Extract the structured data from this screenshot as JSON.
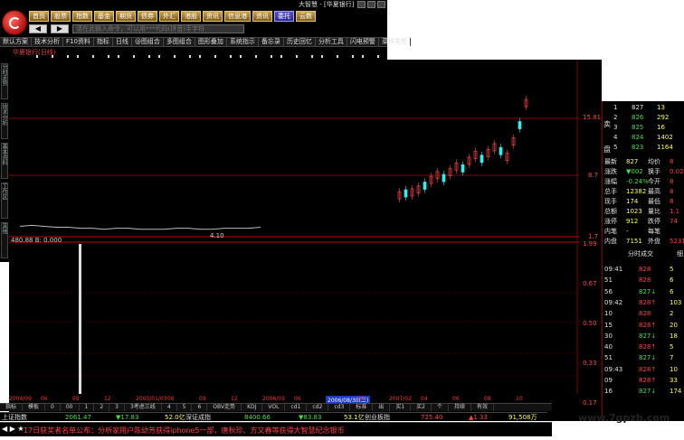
{
  "window": {
    "title": "大智慧 - [华夏银行]"
  },
  "topnav": [
    "首页",
    "股票",
    "指数",
    "基金",
    "期货",
    "债券",
    "外汇",
    "港股",
    "资讯",
    "信息港",
    "资讯",
    "委托",
    "云数"
  ],
  "search": {
    "placeholder": "请在此输入命令，可以用***代码(拼音)手字符",
    "back": "◀",
    "fwd": "▶"
  },
  "toolbar": [
    "默认方案",
    "技术分析",
    "F10资料",
    "指标",
    "日线",
    "@图组合",
    "多图组合",
    "图形叠加",
    "系统指示",
    "备忘录",
    "历史回忆",
    "分析工具",
    "闪电预警",
    "菜样类型"
  ],
  "stock_name": "华夏银行(日线)",
  "vtabs": [
    "分时走势",
    "技术分析",
    "基本资料",
    "工作区",
    "其他"
  ],
  "price_labels": {
    "p1": "15.81",
    "p2": "8.7",
    "p3": "1.7",
    "left_info": "480.88 B: 0.000",
    "right_small": [
      "1.99",
      "0.67",
      "0.50",
      "0.33",
      "0.17"
    ]
  },
  "chart_extra": {
    "low_label": "4.10"
  },
  "order_book": {
    "sell_label": "卖",
    "buy_label": "盘",
    "rows": [
      {
        "idx": "1",
        "price": "827",
        "vol": "13"
      },
      {
        "idx": "2",
        "price": "826",
        "vol": "292"
      },
      {
        "idx": "3",
        "price": "825",
        "vol": "16"
      },
      {
        "idx": "4",
        "price": "824",
        "vol": "1402"
      },
      {
        "idx": "5",
        "price": "823",
        "vol": "1164"
      }
    ]
  },
  "quote": [
    {
      "l": "最新",
      "lv": "827",
      "r": "均价",
      "rv": "8"
    },
    {
      "l": "涨跌",
      "lv": "▼002",
      "r": "换手",
      "rv": "0.02%"
    },
    {
      "l": "涨幅",
      "lv": "-0.24%",
      "r": "今开",
      "rv": "8"
    },
    {
      "l": "总手",
      "lv": "12382",
      "r": "最高",
      "rv": "8"
    },
    {
      "l": "现手",
      "lv": "174",
      "r": "最低",
      "rv": "8"
    },
    {
      "l": "总额",
      "lv": "1023",
      "r": "量比",
      "rv": "1.1"
    },
    {
      "l": "涨停",
      "lv": "912",
      "r": "跌停",
      "rv": "74"
    },
    {
      "l": "内笔",
      "lv": "-",
      "r": "每笔",
      "rv": ""
    },
    {
      "l": "内盘",
      "lv": "7151",
      "r": "外盘",
      "rv": "5231"
    }
  ],
  "ticks_header": {
    "title": "分时成交",
    "right": "细"
  },
  "ticks": [
    {
      "t": "09:41",
      "p": "828",
      "v": "5"
    },
    {
      "t": "51",
      "p": "828",
      "v": "6"
    },
    {
      "t": "56",
      "p": "827↓",
      "v": "6"
    },
    {
      "t": "09:42",
      "p": "828↑",
      "v": "103"
    },
    {
      "t": "10",
      "p": "828",
      "v": "2"
    },
    {
      "t": "15",
      "p": "828↑",
      "v": "20"
    },
    {
      "t": "30",
      "p": "827↓",
      "v": "18"
    },
    {
      "t": "40",
      "p": "828↑",
      "v": "5"
    },
    {
      "t": "51",
      "p": "827↓",
      "v": "7"
    },
    {
      "t": "09:43",
      "p": "828↑",
      "v": "10"
    },
    {
      "t": "09",
      "p": "828↑",
      "v": "33"
    },
    {
      "t": "16",
      "p": "827↓",
      "v": "174"
    }
  ],
  "date_axis": [
    "2004/09",
    "06",
    "09",
    "12",
    "2005/01/03",
    "06",
    "09",
    "12",
    "2006/03",
    "06",
    "2006/08/30(三)",
    "12",
    "2007/02",
    "04",
    "06",
    "08",
    "10"
  ],
  "indicator_tabs": [
    "指标",
    "模板",
    "0",
    "00",
    "1",
    "2",
    "3",
    "3考虑三线",
    "4",
    "5",
    "6",
    "OBV走势",
    "KDJ",
    "VOL",
    "cd1",
    "cd2",
    "cd3",
    "标准",
    "出",
    "买1",
    "买2",
    "个",
    "持续",
    "有效"
  ],
  "ticker": {
    "i1": "上证指数",
    "v1": "2061.47",
    "c1": "▼17.83",
    "a1": "52.0亿",
    "i2": "深证成指",
    "v2": "8400.66",
    "c2": "▼83.83",
    "a2": "53.1亿",
    "i3": "创业板指",
    "v3": "725.40",
    "c3": "▲1.33",
    "a3": "91,508万"
  },
  "news": {
    "arrows": "◀ ▶ ★",
    "text": "17日获奖者名单公布：分析家用户陈幼芳获得iphone5一部，唐秋珍、方又春等获得大智慧纪念银币"
  },
  "watermark": "www.7gpzb.com",
  "chart_data": {
    "type": "line",
    "series": [
      {
        "values": [
          4.1,
          4.2,
          4.1,
          4.0,
          4.0,
          3.9,
          3.9,
          3.8,
          3.9,
          3.9,
          3.8,
          3.8,
          3.8,
          3.9,
          3.9,
          3.8,
          3.8,
          3.9,
          3.9,
          3.9,
          4.0
        ]
      },
      {
        "values": [
          6.2,
          6.4,
          6.5,
          6.8,
          7.2,
          7.8,
          8.3,
          8.0,
          8.6,
          9.2,
          9.0,
          9.8,
          10.4,
          10.0,
          10.6,
          11.2,
          10.8,
          10.2,
          11.8,
          13.5,
          15.8
        ]
      }
    ],
    "ylim": [
      1.7,
      15.81
    ]
  }
}
